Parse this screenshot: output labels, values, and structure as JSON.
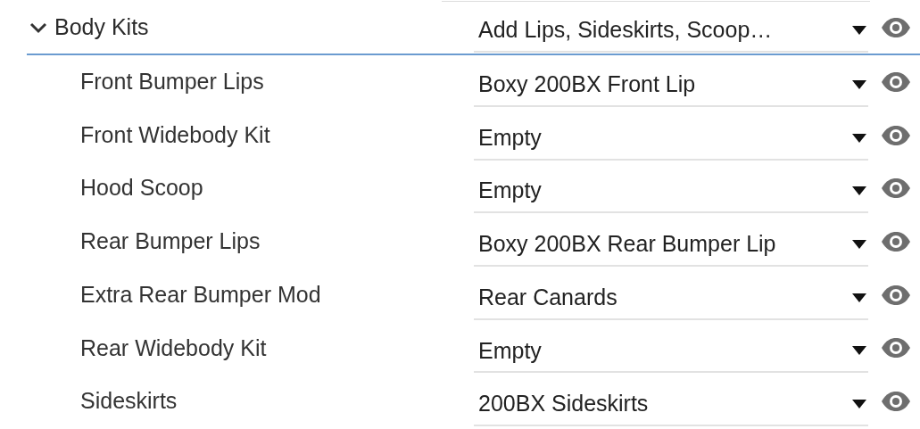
{
  "group": {
    "label": "Body Kits",
    "value": "Add Lips, Sideskirts, Scoop…",
    "expanded": true,
    "items": [
      {
        "label": "Front Bumper Lips",
        "value": "Boxy 200BX Front Lip"
      },
      {
        "label": "Front Widebody Kit",
        "value": "Empty"
      },
      {
        "label": "Hood Scoop",
        "value": "Empty"
      },
      {
        "label": "Rear Bumper Lips",
        "value": "Boxy 200BX Rear Bumper Lip"
      },
      {
        "label": "Extra Rear Bumper Mod",
        "value": "Rear Canards"
      },
      {
        "label": "Rear Widebody Kit",
        "value": "Empty"
      },
      {
        "label": "Sideskirts",
        "value": "200BX Sideskirts"
      }
    ]
  }
}
